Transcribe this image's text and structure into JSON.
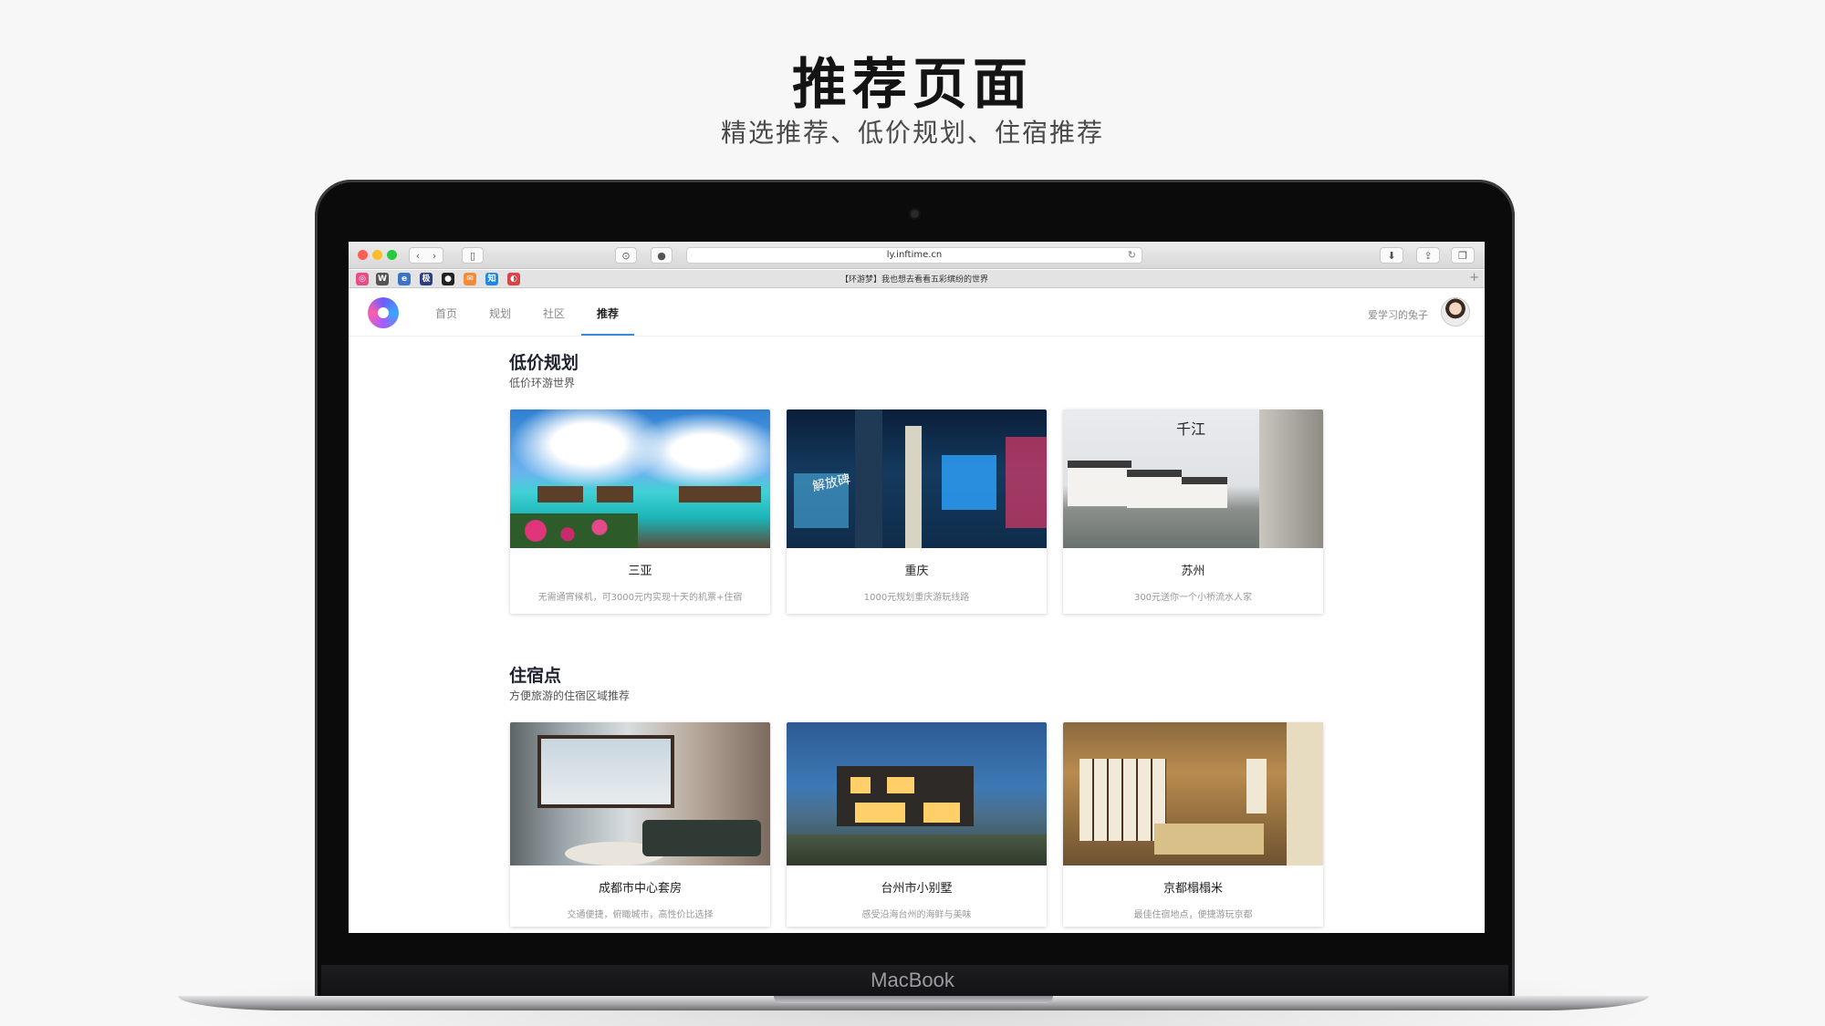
{
  "hero": {
    "title": "推荐页面",
    "subtitle": "精选推荐、低价规划、住宿推荐"
  },
  "device": {
    "brand": "MacBook"
  },
  "browser": {
    "address": "ly.inftime.cn",
    "tab_title": "【环游梦】我也想去看看五彩缤纷的世界",
    "bookmarks": [
      {
        "icon": "dribbble-icon",
        "glyph": "◎",
        "color": "#ea4c89"
      },
      {
        "icon": "wikipedia-icon",
        "glyph": "W",
        "color": "#ffffff"
      },
      {
        "icon": "browser-icon",
        "glyph": "e",
        "color": "#3b73c9"
      },
      {
        "icon": "app-icon",
        "glyph": "极",
        "color": "#2f3b86"
      },
      {
        "icon": "github-icon",
        "glyph": "●",
        "color": "#222222"
      },
      {
        "icon": "mail-icon",
        "glyph": "✉",
        "color": "#f28c38"
      },
      {
        "icon": "zhihu-icon",
        "glyph": "知",
        "color": "#1e88e5"
      },
      {
        "icon": "photo-icon",
        "glyph": "◐",
        "color": "#d9434a"
      }
    ]
  },
  "nav": {
    "items": [
      "首页",
      "规划",
      "社区",
      "推荐"
    ],
    "active": "推荐",
    "username": "爱学习的兔子"
  },
  "sections": {
    "budget": {
      "title": "低价规划",
      "subtitle": "低价环游世界",
      "cards": [
        {
          "name": "三亚",
          "desc": "无需通宵候机，可3000元内实现十天的机票+住宿"
        },
        {
          "name": "重庆",
          "desc": "1000元规划重庆游玩线路"
        },
        {
          "name": "苏州",
          "desc": "300元送你一个小桥流水人家"
        }
      ]
    },
    "lodging": {
      "title": "住宿点",
      "subtitle": "方便旅游的住宿区域推荐",
      "cards": [
        {
          "name": "成都市中心套房",
          "desc": "交通便捷，俯瞰城市，高性价比选择"
        },
        {
          "name": "台州市小别墅",
          "desc": "感受沿海台州的海鲜与美味"
        },
        {
          "name": "京都榻榻米",
          "desc": "最佳住宿地点，便捷游玩京都"
        }
      ]
    }
  },
  "image_text": {
    "chongqing_sign": "解放碑",
    "suzhou_calligraphy": "千江"
  },
  "colors": {
    "accent": "#3b8ad9",
    "page_bg": "#f7f7f7"
  }
}
